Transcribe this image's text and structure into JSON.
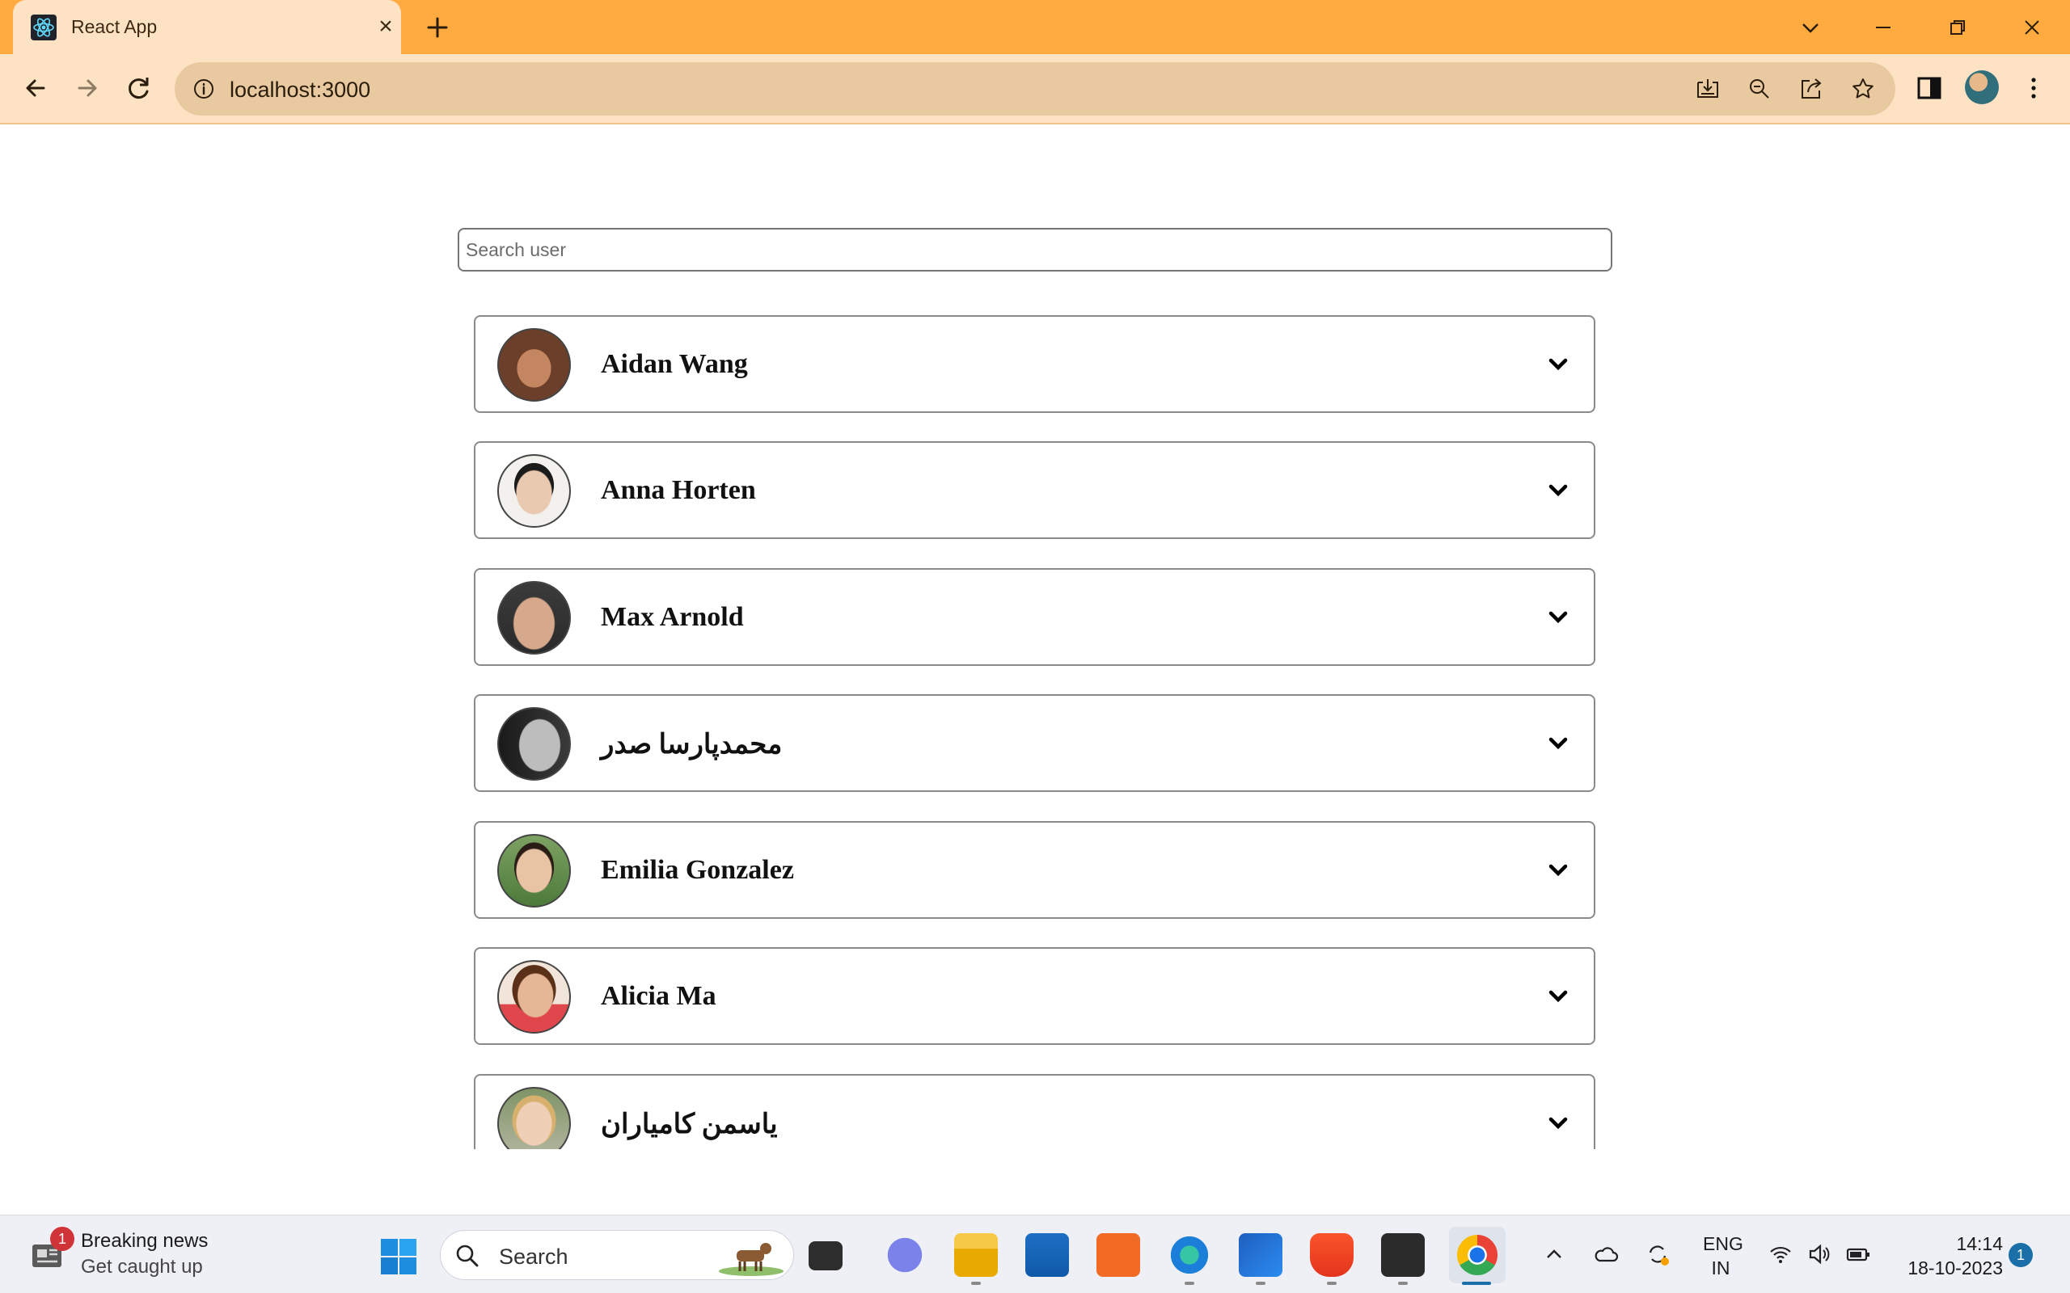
{
  "browser": {
    "tab_title": "React App",
    "url": "localhost:3000",
    "accent_color": "#ffab40"
  },
  "page": {
    "search_placeholder": "Search user",
    "users": [
      {
        "name": "Aidan Wang",
        "rtl": false
      },
      {
        "name": "Anna Horten",
        "rtl": false
      },
      {
        "name": "Max Arnold",
        "rtl": false
      },
      {
        "name": "محمدپارسا صدر",
        "rtl": true
      },
      {
        "name": "Emilia Gonzalez",
        "rtl": false
      },
      {
        "name": "Alicia Ma",
        "rtl": false
      },
      {
        "name": "یاسمن کامیاران",
        "rtl": true
      }
    ]
  },
  "taskbar": {
    "news_badge": "1",
    "news_title": "Breaking news",
    "news_subtitle": "Get caught up",
    "search_label": "Search",
    "lang_line1": "ENG",
    "lang_line2": "IN",
    "time": "14:14",
    "date": "18-10-2023",
    "notification_count": "1"
  }
}
